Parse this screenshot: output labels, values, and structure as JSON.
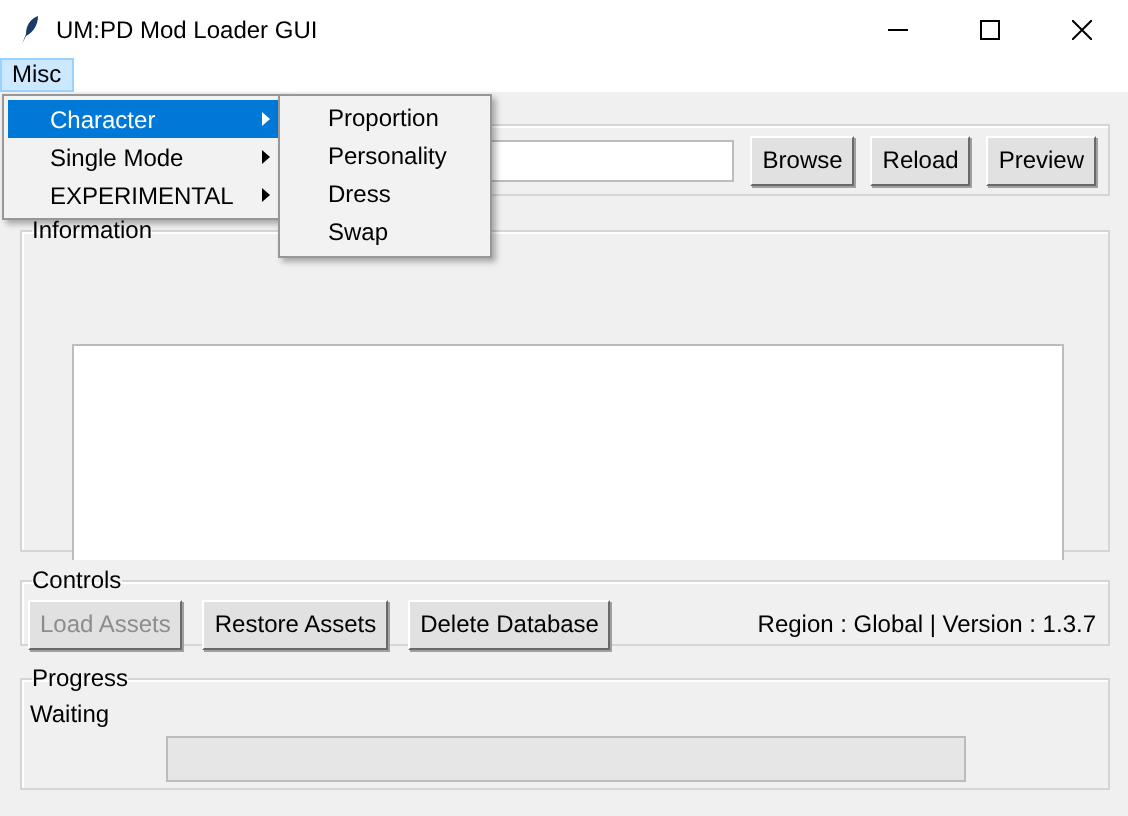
{
  "window": {
    "title": "UM:PD Mod Loader GUI"
  },
  "menu_bar": [
    {
      "label": "Misc",
      "selected": true
    }
  ],
  "menu": [
    {
      "label": "Character",
      "selected": true
    },
    {
      "label": "Single Mode",
      "selected": false
    },
    {
      "label": "EXPERIMENTAL",
      "selected": false
    }
  ],
  "submenu": [
    "Proportion",
    "Personality",
    "Dress",
    "Swap"
  ],
  "file_buttons": [
    "Browse",
    "Reload",
    "Preview"
  ],
  "information": {
    "title": "Information"
  },
  "controls": {
    "title": "Controls",
    "buttons": [
      {
        "label": "Load Assets",
        "disabled": true
      },
      {
        "label": "Restore Assets",
        "disabled": false
      },
      {
        "label": "Delete Database",
        "disabled": false
      }
    ],
    "info": "Region : Global |  Version : 1.3.7"
  },
  "progress": {
    "title": "Progress",
    "status": "Waiting"
  }
}
